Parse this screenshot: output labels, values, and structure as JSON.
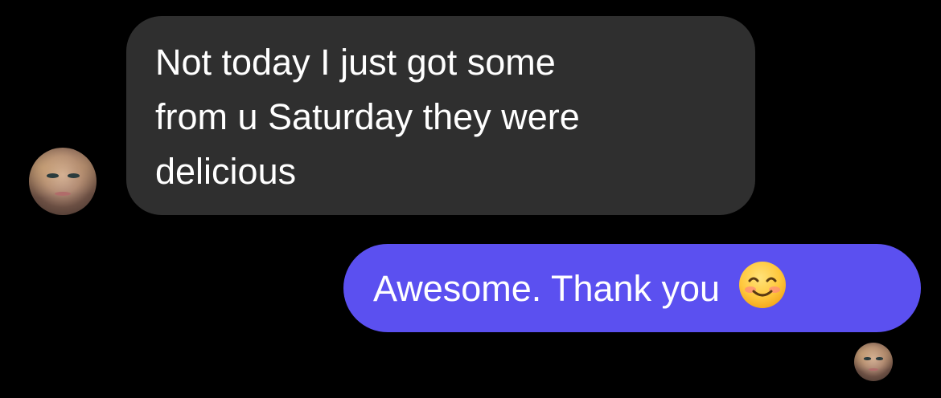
{
  "conversation": {
    "incoming_message": {
      "lines": [
        "Not today I just got some",
        "from u Saturday they were",
        "delicious"
      ]
    },
    "outgoing_message": {
      "text": "Awesome. Thank you",
      "emoji": "smiling-face-with-smiling-eyes"
    }
  },
  "colors": {
    "background": "#000000",
    "incoming_bubble": "#2f2f2f",
    "outgoing_bubble": "#5b50f0",
    "text": "#ffffff"
  }
}
